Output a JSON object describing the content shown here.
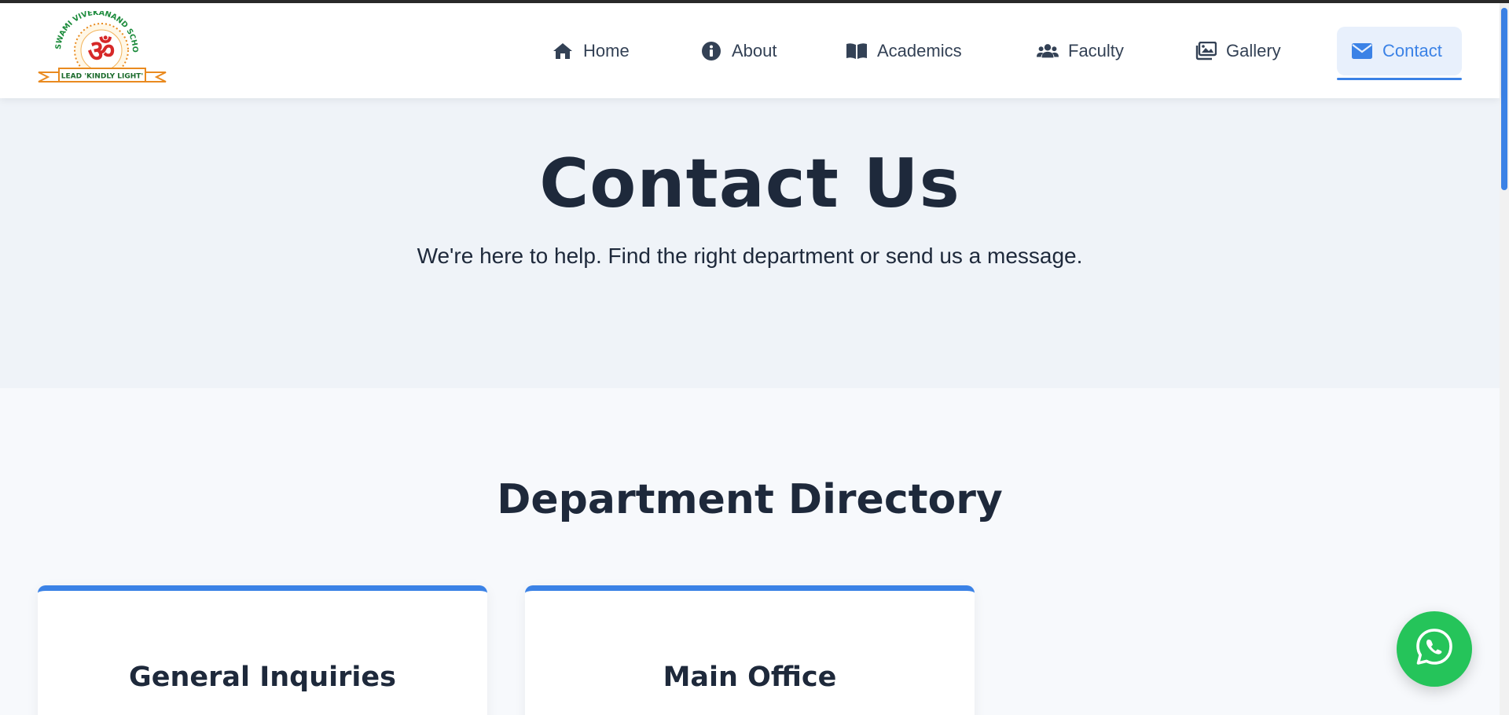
{
  "logo": {
    "school_name": "SWAMI VIVEKANAND SCHOOL",
    "motto": "LEAD 'KINDLY LIGHT'",
    "symbol": "ॐ"
  },
  "nav": {
    "items": [
      {
        "label": "Home",
        "icon": "home-icon"
      },
      {
        "label": "About",
        "icon": "info-icon"
      },
      {
        "label": "Academics",
        "icon": "book-icon"
      },
      {
        "label": "Faculty",
        "icon": "users-icon"
      },
      {
        "label": "Gallery",
        "icon": "images-icon"
      },
      {
        "label": "Contact",
        "icon": "envelope-icon",
        "active": true
      }
    ]
  },
  "hero": {
    "title": "Contact Us",
    "subtitle": "We're here to help. Find the right department or send us a message."
  },
  "directory": {
    "title": "Department Directory",
    "cards": [
      {
        "title": "General Inquiries"
      },
      {
        "title": "Main Office"
      }
    ]
  },
  "fab": {
    "icon": "whatsapp-icon"
  },
  "colors": {
    "accent": "#3b82e6",
    "text_dark": "#1e293b",
    "nav_text": "#334155",
    "hero_bg": "#eff3f8",
    "page_bg": "#f7f9fc",
    "whatsapp_green": "#25c45a",
    "logo_green": "#1a8a3a",
    "logo_orange": "#e98a1f",
    "logo_red": "#d62828"
  }
}
